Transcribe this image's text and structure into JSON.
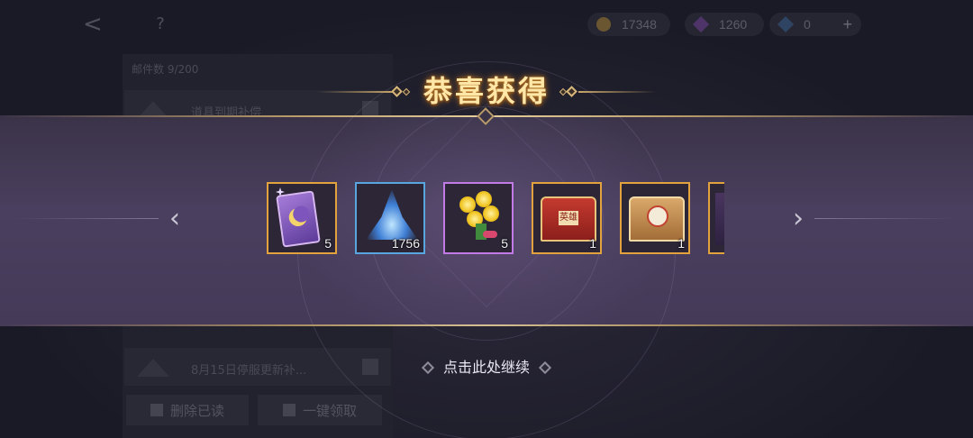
{
  "background": {
    "currencies": [
      {
        "icon": "gold-coin-icon",
        "value": "17348"
      },
      {
        "icon": "purple-gem-icon",
        "value": "1260"
      },
      {
        "icon": "blue-gem-icon",
        "value": "0"
      }
    ],
    "plus_label": "+",
    "back_label": "<",
    "help_label": "?",
    "mail_count": "邮件数  9/200",
    "mail_items": [
      {
        "title": "道具到期补偿"
      },
      {
        "title": "8月15日停服更新补..."
      }
    ],
    "delete_read_label": "删除已读",
    "claim_all_label": "一键领取"
  },
  "reward": {
    "title": "恭喜获得",
    "items": [
      {
        "name": "purple-card",
        "quantity": "5",
        "rarity": "gold"
      },
      {
        "name": "blue-crystal",
        "quantity": "1756",
        "rarity": "blue"
      },
      {
        "name": "yellow-bouquet",
        "quantity": "5",
        "rarity": "purple"
      },
      {
        "name": "hero-chest",
        "quantity": "1",
        "rarity": "gold",
        "label": "英雄"
      },
      {
        "name": "skin-chest",
        "quantity": "1",
        "rarity": "gold"
      },
      {
        "name": "partial-item",
        "quantity": "",
        "rarity": "gold"
      }
    ],
    "prev_label": "‹",
    "next_label": "›",
    "continue_label": "点击此处继续"
  },
  "colors": {
    "gold_frame": "#e2a33f",
    "blue_frame": "#57a6e0",
    "purple_frame": "#c27ae6",
    "title_glow": "#ffe7a8"
  }
}
